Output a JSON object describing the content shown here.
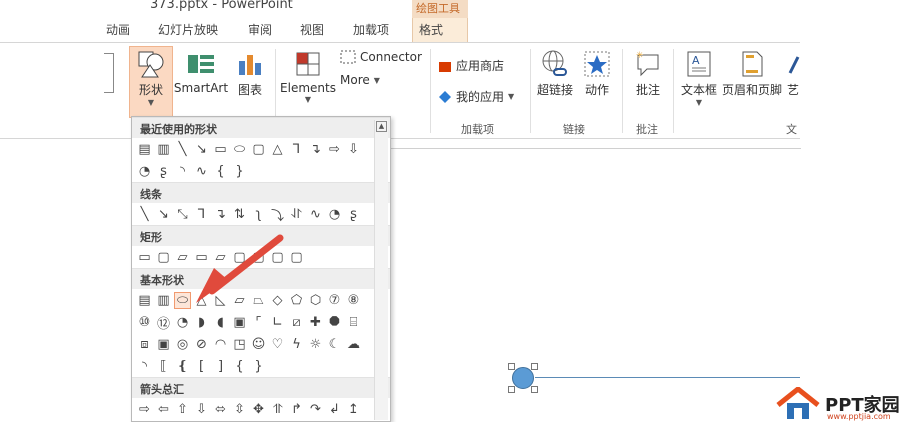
{
  "window": {
    "title": "373.pptx - PowerPoint",
    "context_tab_group": "绘图工具"
  },
  "tabs": [
    "动画",
    "幻灯片放映",
    "审阅",
    "视图",
    "加载项",
    "格式"
  ],
  "ribbon": {
    "shapes": "形状",
    "smartart": "SmartArt",
    "chart": "图表",
    "elements": "Elements",
    "connector": "Connector",
    "more": "More",
    "app_store": "应用商店",
    "my_apps": "我的应用",
    "addins_group": "加载项",
    "hyperlink": "超链接",
    "action": "动作",
    "links_group": "链接",
    "comment": "批注",
    "comment_group": "批注",
    "textbox": "文本框",
    "header_footer": "页眉和页脚",
    "wordart": "艺",
    "text_group": "文"
  },
  "dropdown": {
    "recent": "最近使用的形状",
    "lines": "线条",
    "rectangles": "矩形",
    "basic": "基本形状",
    "arrows": "箭头总汇"
  },
  "watermark": {
    "brand": "PPT家园",
    "url": "www.pptjia.com"
  }
}
